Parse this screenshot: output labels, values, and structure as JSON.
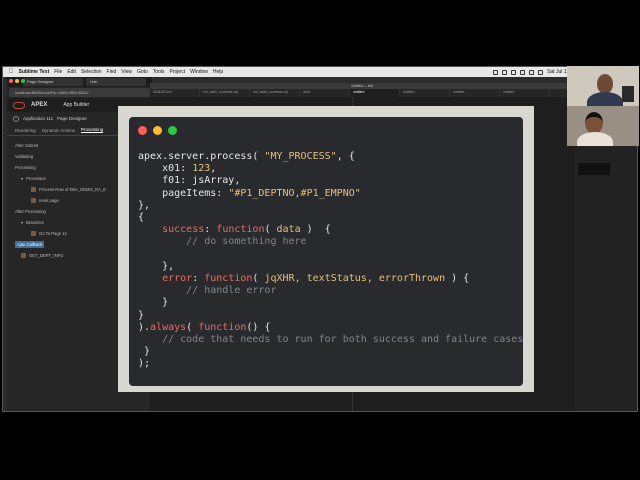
{
  "menubar": {
    "app_name": "Sublime Text",
    "items": [
      "File",
      "Edit",
      "Selection",
      "Find",
      "View",
      "Goto",
      "Tools",
      "Project",
      "Window",
      "Help"
    ],
    "clock": "Sat Jul 11"
  },
  "browser": {
    "tabs": [
      "Page Designer",
      "Hub"
    ],
    "url": "localhost:8080/ords/f?p=4000:4500:6240:",
    "app_label": "APEX",
    "builder_label": "App Builder",
    "page_designer": {
      "app_ref": "Application 111",
      "title": "Page Designer"
    },
    "pd_tabs": [
      "Rendering",
      "Dynamic Actions",
      "Processing"
    ],
    "pd_active_tab": "Processing",
    "tree": [
      {
        "label": "After Submit",
        "level": "l1"
      },
      {
        "label": "Validating",
        "level": "l1"
      },
      {
        "label": "Processing",
        "level": "l1"
      },
      {
        "label": "Processes",
        "level": "l2"
      },
      {
        "label": "Process Row of EBA_DEMO_DA_E",
        "level": "l3"
      },
      {
        "label": "reset page",
        "level": "l3"
      },
      {
        "label": "After Processing",
        "level": "l1"
      },
      {
        "label": "Branches",
        "level": "l2"
      },
      {
        "label": "Go To Page 12",
        "level": "l3"
      },
      {
        "label": "Ajax Callback",
        "level": "l1",
        "selected": true
      },
      {
        "label": "GET_DEPT_INFO",
        "level": "l2"
      }
    ]
  },
  "sublime": {
    "title": "untitled — ext",
    "tabs": [
      "8D6D83.ext",
      "ext_table_contents.sql",
      "ext_table_contents.sql",
      "all.ts",
      "untitled",
      "untitled",
      "untitled",
      "untitled"
    ],
    "active_tab_index": 4
  },
  "code_card": {
    "lines": [
      "apex.server.process( \"MY_PROCESS\", {",
      "    x01: 123,",
      "    f01: jsArray,",
      "    pageItems: \"#P1_DEPTNO,#P1_EMPNO\"",
      "},",
      "{",
      "    success: function( data )  {",
      "        // do something here",
      "",
      "    },",
      "    error: function( jqXHR, textStatus, errorThrown ) {",
      "        // handle error",
      "    }",
      "}",
      ").always( function() {",
      "    // code that needs to run for both success and failure cases",
      " }",
      ");"
    ]
  },
  "colors": {
    "close": "#ff5f57",
    "minimize": "#febc2e",
    "zoom": "#28c840",
    "apex_brand": "#c74634"
  }
}
